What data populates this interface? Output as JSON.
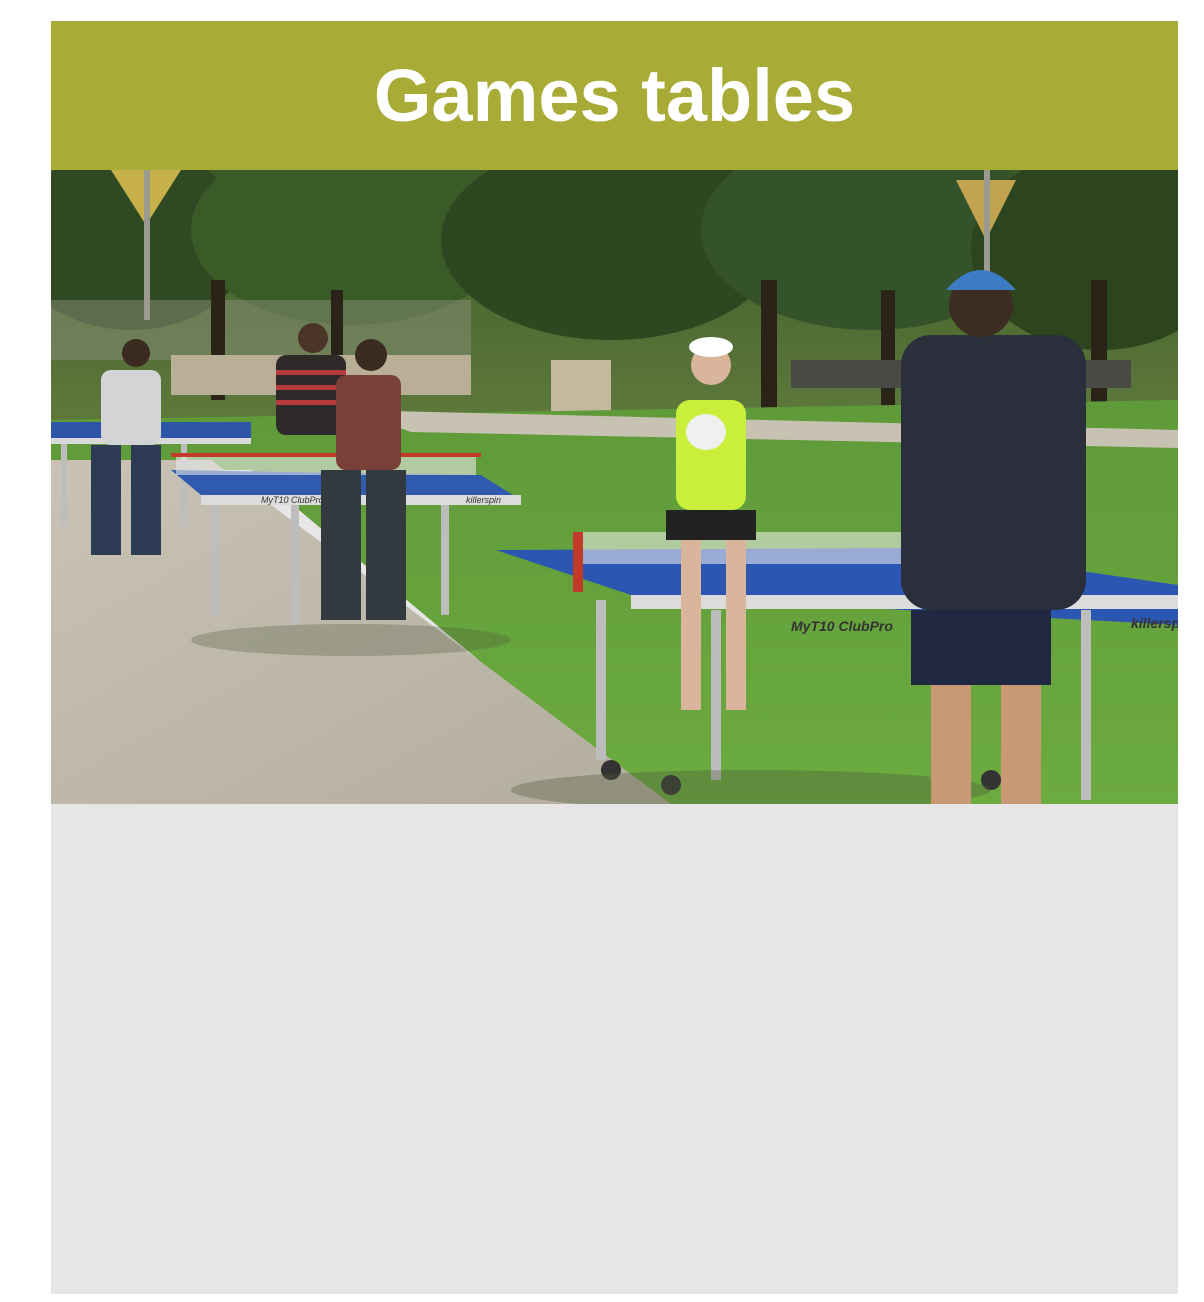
{
  "card": {
    "title": "Games tables",
    "header_color": "#a8ab36",
    "background_color": "#e6e6e6"
  },
  "photo": {
    "subject": "people-playing-table-tennis-outdoors",
    "table_labels": {
      "model_left": "MyT10 ClubPro",
      "brand_left": "killerspin",
      "model_right": "MyT10 ClubPro",
      "brand_right": "killersp"
    }
  }
}
